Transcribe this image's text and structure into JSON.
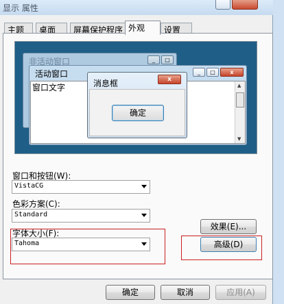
{
  "window": {
    "title": "显示 属性",
    "tabs": [
      "主题",
      "桌面",
      "屏幕保护程序",
      "外观",
      "设置"
    ],
    "active_tab": "外观"
  },
  "preview": {
    "inactive_title": "非活动窗口",
    "active_title": "活动窗口",
    "window_text": "窗口文字",
    "msgbox_title": "消息框",
    "msgbox_ok": "确定",
    "colors": {
      "desktop": "#1f5f87",
      "close_button": "#c6442b"
    }
  },
  "settings": {
    "windows_buttons_label": "窗口和按钮(W):",
    "windows_buttons_value": "VistaCG",
    "color_scheme_label": "色彩方案(C):",
    "color_scheme_value": "Standard",
    "font_size_label": "字体大小(F):",
    "font_size_value": "Tahoma",
    "effects_button": "效果(E)...",
    "advanced_button": "高级(D)"
  },
  "footer": {
    "ok": "确定",
    "cancel": "取消",
    "apply": "应用(A)"
  },
  "annotation_color": "#c91e1e"
}
